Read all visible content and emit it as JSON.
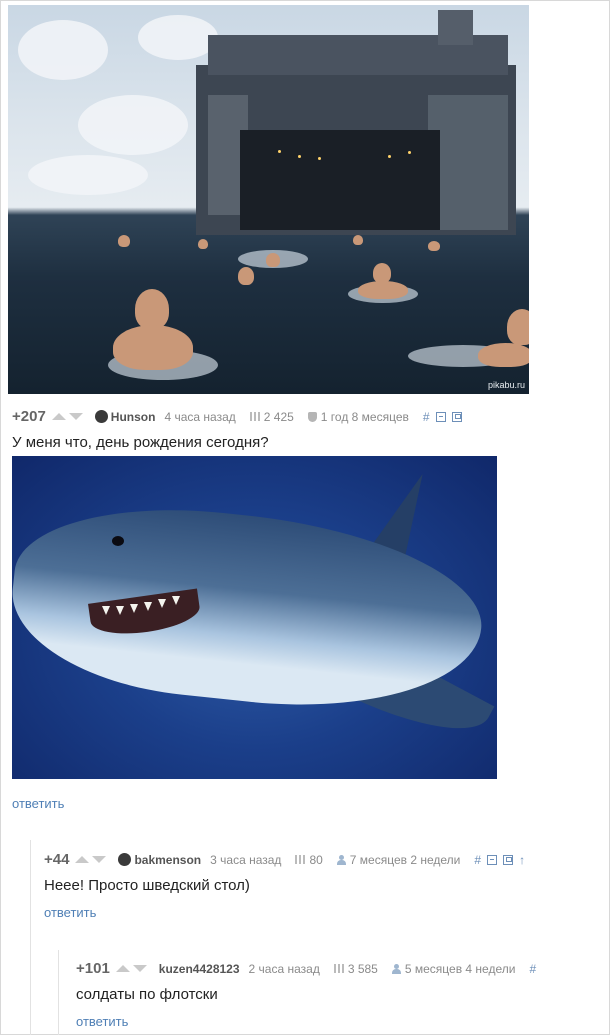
{
  "post_image": {
    "watermark": "pikabu.ru"
  },
  "comments": [
    {
      "rating": "+207",
      "username": "Hunson",
      "time": "4 часа назад",
      "views": "2 425",
      "account_age": "1 год 8 месяцев",
      "hash": "#",
      "text": "У меня что, день рождения сегодня?",
      "reply_label": "ответить"
    },
    {
      "rating": "+44",
      "username": "bakmenson",
      "time": "3 часа назад",
      "views": "80",
      "account_age": "7 месяцев 2 недели",
      "hash": "#",
      "up_arrow": "↑",
      "text": "Неее! Просто шведский стол)",
      "reply_label": "ответить"
    },
    {
      "rating": "+101",
      "username": "kuzen4428123",
      "time": "2 часа назад",
      "views": "3 585",
      "account_age": "5 месяцев 4 недели",
      "hash": "#",
      "text": "солдаты по флотски",
      "reply_label": "ответить"
    }
  ],
  "colors": {
    "link": "#4f7fb5",
    "meta": "#8a8a8a",
    "rating": "#666666"
  }
}
